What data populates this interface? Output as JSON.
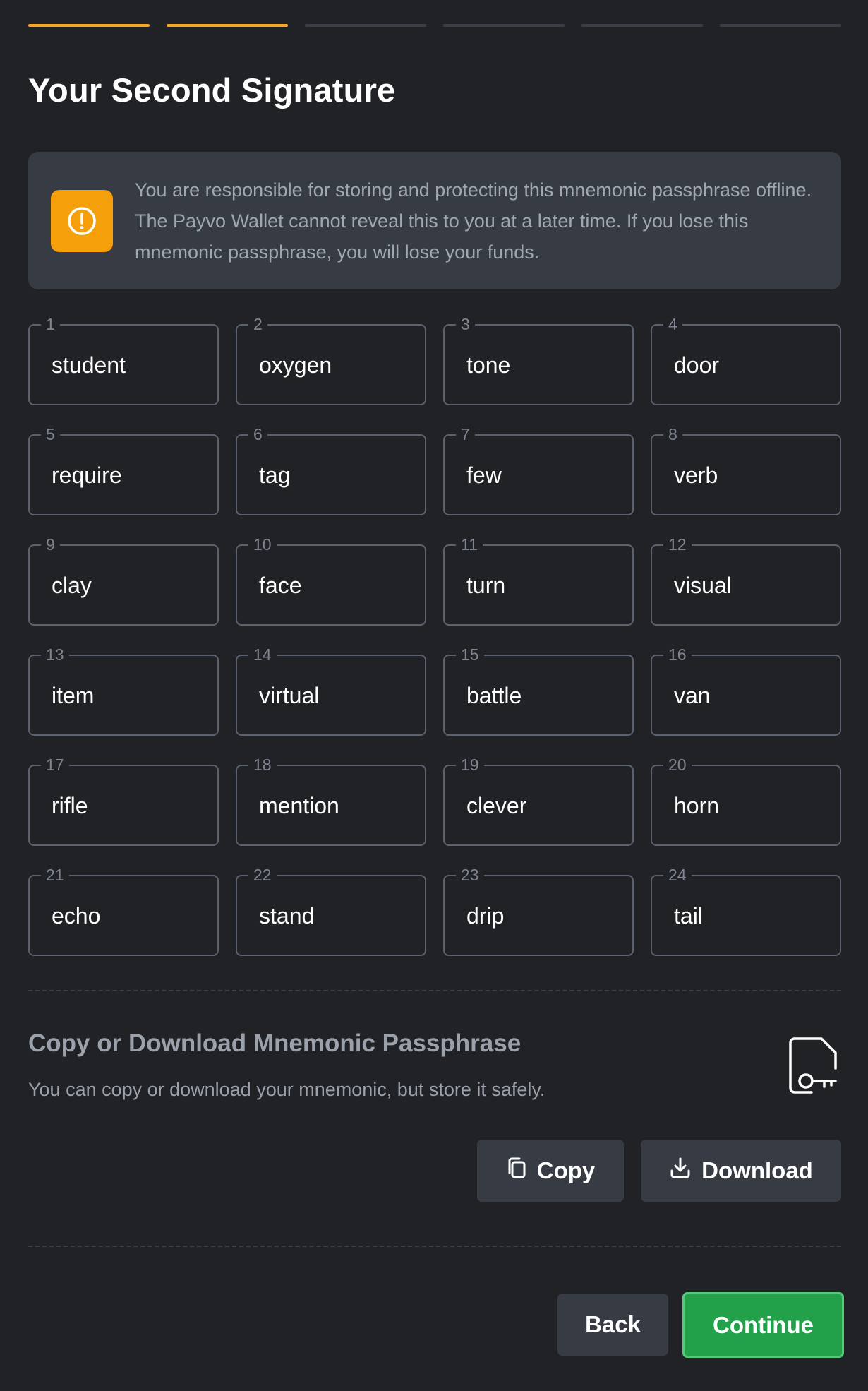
{
  "progress": {
    "total_steps": 6,
    "completed_steps": 2,
    "active_color": "#f5a524",
    "inactive_color": "#3a3f47"
  },
  "page": {
    "title": "Your Second Signature"
  },
  "warning": {
    "icon": "alert-circle-icon",
    "icon_bg": "#f59f0a",
    "text": "You are responsible for storing and protecting this mnemonic passphrase offline. The Payvo Wallet cannot reveal this to you at a later time. If you lose this mnemonic passphrase, you will lose your funds."
  },
  "mnemonic": {
    "words": [
      {
        "index": "1",
        "word": "student"
      },
      {
        "index": "2",
        "word": "oxygen"
      },
      {
        "index": "3",
        "word": "tone"
      },
      {
        "index": "4",
        "word": "door"
      },
      {
        "index": "5",
        "word": "require"
      },
      {
        "index": "6",
        "word": "tag"
      },
      {
        "index": "7",
        "word": "few"
      },
      {
        "index": "8",
        "word": "verb"
      },
      {
        "index": "9",
        "word": "clay"
      },
      {
        "index": "10",
        "word": "face"
      },
      {
        "index": "11",
        "word": "turn"
      },
      {
        "index": "12",
        "word": "visual"
      },
      {
        "index": "13",
        "word": "item"
      },
      {
        "index": "14",
        "word": "virtual"
      },
      {
        "index": "15",
        "word": "battle"
      },
      {
        "index": "16",
        "word": "van"
      },
      {
        "index": "17",
        "word": "rifle"
      },
      {
        "index": "18",
        "word": "mention"
      },
      {
        "index": "19",
        "word": "clever"
      },
      {
        "index": "20",
        "word": "horn"
      },
      {
        "index": "21",
        "word": "echo"
      },
      {
        "index": "22",
        "word": "stand"
      },
      {
        "index": "23",
        "word": "drip"
      },
      {
        "index": "24",
        "word": "tail"
      }
    ]
  },
  "copy_section": {
    "title": "Copy or Download Mnemonic Passphrase",
    "description": "You can copy or download your mnemonic, but store it safely.",
    "icon": "file-key-icon",
    "copy_label": "Copy",
    "copy_icon": "copy-icon",
    "download_label": "Download",
    "download_icon": "download-icon"
  },
  "footer": {
    "back_label": "Back",
    "continue_label": "Continue",
    "continue_color": "#22a04a"
  }
}
